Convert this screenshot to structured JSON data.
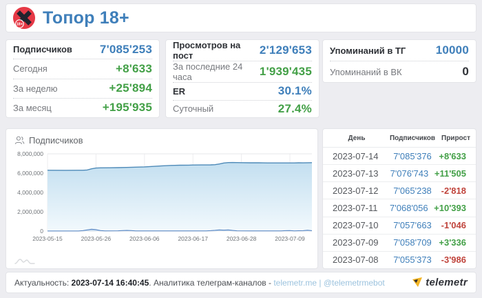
{
  "header": {
    "title": "Топор 18+",
    "avatar_badge": "18+"
  },
  "colors": {
    "accent_blue": "#3f7fba",
    "green": "#43a047",
    "red": "#c0443c",
    "dark_value": "#2e3136",
    "link_light_blue": "#9cc3de",
    "chart_line": "#4d8ab8",
    "chart_fill_top": "#c3dff0",
    "chart_fill_bottom": "#f2f9fd",
    "growth_line": "#4d7ebf",
    "avatar_red": "#e63946",
    "brand_yellow": "#f2b424"
  },
  "stat_cards": [
    {
      "name": "subscribers-card",
      "rows": [
        {
          "label": "Подписчиков",
          "value": "7'085'253",
          "value_color": "#3f7fba",
          "emphasis": true
        },
        {
          "label": "Сегодня",
          "value": "+8'633",
          "value_color": "#43a047",
          "emphasis": false
        },
        {
          "label": "За неделю",
          "value": "+25'894",
          "value_color": "#43a047",
          "emphasis": false
        },
        {
          "label": "За месяц",
          "value": "+195'935",
          "value_color": "#43a047",
          "emphasis": false
        }
      ]
    },
    {
      "name": "views-card",
      "rows": [
        {
          "label": "Просмотров на пост",
          "value": "2'129'653",
          "value_color": "#3f7fba",
          "emphasis": true
        },
        {
          "label": "За последние 24 часа",
          "value": "1'939'435",
          "value_color": "#43a047",
          "emphasis": false
        },
        {
          "label": "ER",
          "value": "30.1%",
          "value_color": "#3f7fba",
          "emphasis": true
        },
        {
          "label": "Суточный",
          "value": "27.4%",
          "value_color": "#43a047",
          "emphasis": false
        }
      ]
    },
    {
      "name": "mentions-card",
      "rows": [
        {
          "label": "Упоминаний в ТГ",
          "value": "10000",
          "value_color": "#3f7fba",
          "emphasis": true
        },
        {
          "label": "Упоминаний в ВК",
          "value": "0",
          "value_color": "#2e3136",
          "emphasis": false
        }
      ]
    }
  ],
  "chart": {
    "title": "Подписчиков",
    "y_ticks": [
      "8,000,000",
      "6,000,000",
      "4,000,000",
      "2,000,000",
      "0"
    ],
    "x_ticks": [
      "2023-05-15",
      "2023-05-26",
      "2023-06-06",
      "2023-06-17",
      "2023-06-28",
      "2023-07-09"
    ]
  },
  "chart_data": {
    "type": "area",
    "title": "Подписчиков",
    "x_start_date": "2023-05-15",
    "x_end_date": "2023-07-14",
    "x_tick_days": [
      0,
      11,
      22,
      33,
      44,
      55
    ],
    "x_tick_labels": [
      "2023-05-15",
      "2023-05-26",
      "2023-06-06",
      "2023-06-17",
      "2023-06-28",
      "2023-07-09"
    ],
    "ylim": [
      0,
      8000000
    ],
    "y_tick_values": [
      0,
      2000000,
      4000000,
      6000000,
      8000000
    ],
    "y_tick_labels": [
      "0",
      "2,000,000",
      "4,000,000",
      "6,000,000",
      "8,000,000"
    ],
    "grid": true,
    "series": [
      {
        "name": "Подписчиков",
        "points": [
          [
            0,
            6300000
          ],
          [
            4,
            6295000
          ],
          [
            7,
            6298000
          ],
          [
            8,
            6300000
          ],
          [
            9,
            6330000
          ],
          [
            10,
            6450000
          ],
          [
            11,
            6530000
          ],
          [
            12,
            6550000
          ],
          [
            14,
            6560000
          ],
          [
            16,
            6575000
          ],
          [
            18,
            6590000
          ],
          [
            20,
            6620000
          ],
          [
            22,
            6650000
          ],
          [
            24,
            6700000
          ],
          [
            26,
            6760000
          ],
          [
            28,
            6800000
          ],
          [
            30,
            6820000
          ],
          [
            32,
            6830000
          ],
          [
            33,
            6840000
          ],
          [
            35,
            6850000
          ],
          [
            37,
            6860000
          ],
          [
            38,
            6880000
          ],
          [
            39,
            6950000
          ],
          [
            40,
            7050000
          ],
          [
            41,
            7090000
          ],
          [
            42,
            7100000
          ],
          [
            43,
            7095000
          ],
          [
            44,
            7085000
          ],
          [
            46,
            7075000
          ],
          [
            48,
            7070000
          ],
          [
            50,
            7060000
          ],
          [
            52,
            7060000
          ],
          [
            53,
            7058000
          ],
          [
            54,
            7055000
          ],
          [
            55,
            7059000
          ],
          [
            56,
            7058000
          ],
          [
            57,
            7068000
          ],
          [
            58,
            7065000
          ],
          [
            59,
            7077000
          ],
          [
            60,
            7085000
          ]
        ]
      },
      {
        "name": "Прирост",
        "points": [
          [
            0,
            10000
          ],
          [
            7,
            10000
          ],
          [
            8,
            40000
          ],
          [
            9,
            120000
          ],
          [
            10,
            200000
          ],
          [
            11,
            150000
          ],
          [
            12,
            60000
          ],
          [
            13,
            20000
          ],
          [
            16,
            30000
          ],
          [
            17,
            60000
          ],
          [
            18,
            70000
          ],
          [
            19,
            50000
          ],
          [
            20,
            20000
          ],
          [
            24,
            15000
          ],
          [
            28,
            15000
          ],
          [
            32,
            15000
          ],
          [
            36,
            20000
          ],
          [
            37,
            40000
          ],
          [
            38,
            80000
          ],
          [
            39,
            130000
          ],
          [
            40,
            100000
          ],
          [
            41,
            130000
          ],
          [
            42,
            70000
          ],
          [
            43,
            30000
          ],
          [
            46,
            15000
          ],
          [
            50,
            15000
          ],
          [
            53,
            25000
          ],
          [
            54,
            40000
          ],
          [
            55,
            60000
          ],
          [
            56,
            25000
          ],
          [
            57,
            35000
          ],
          [
            58,
            45000
          ],
          [
            59,
            90000
          ],
          [
            60,
            40000
          ]
        ]
      }
    ]
  },
  "table": {
    "headers": [
      "День",
      "Подписчиков",
      "Прирост"
    ],
    "rows": [
      {
        "date": "2023-07-14",
        "subscribers": "7'085'376",
        "growth": "+8'633"
      },
      {
        "date": "2023-07-13",
        "subscribers": "7'076'743",
        "growth": "+11'505"
      },
      {
        "date": "2023-07-12",
        "subscribers": "7'065'238",
        "growth": "-2'818"
      },
      {
        "date": "2023-07-11",
        "subscribers": "7'068'056",
        "growth": "+10'393"
      },
      {
        "date": "2023-07-10",
        "subscribers": "7'057'663",
        "growth": "-1'046"
      },
      {
        "date": "2023-07-09",
        "subscribers": "7'058'709",
        "growth": "+3'336"
      },
      {
        "date": "2023-07-08",
        "subscribers": "7'055'373",
        "growth": "-3'986"
      }
    ]
  },
  "footer": {
    "label": "Актуальность: ",
    "timestamp": "2023-07-14 16:40:45",
    "middle_text": ". Аналитика телеграм-каналов - ",
    "link_site": "telemetr.me",
    "separator": " | ",
    "link_bot": "@telemetrmebot",
    "brand": "telemetr"
  }
}
